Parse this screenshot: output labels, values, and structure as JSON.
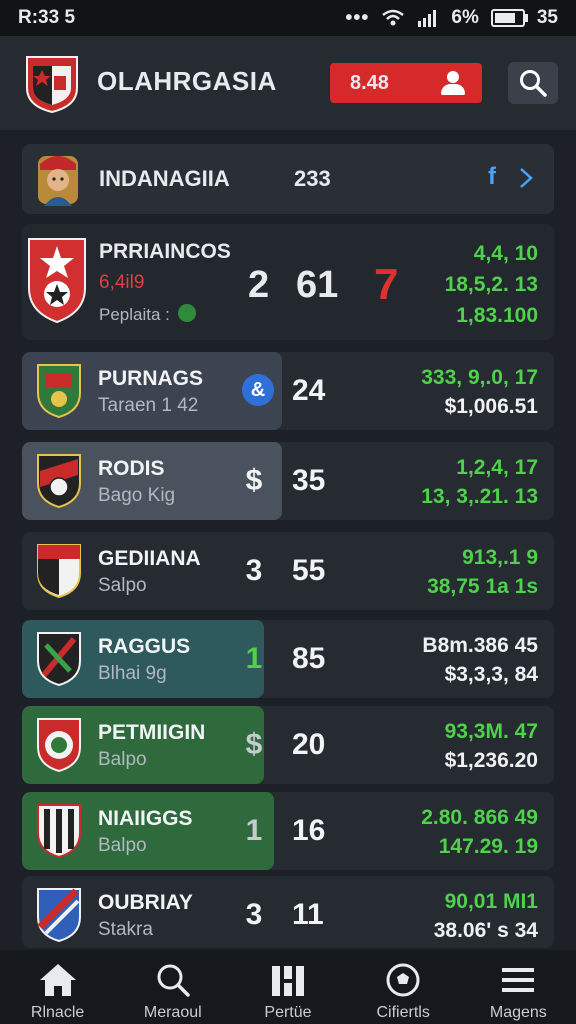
{
  "status": {
    "time": "R:33 5",
    "battery_text": "6%",
    "signal_text": "35",
    "battery_level": 0.85
  },
  "header": {
    "title": "OLAHRGASIA",
    "balance": "8.48",
    "icons": [
      "club-crest-icon",
      "user-icon",
      "search-icon"
    ]
  },
  "featured": {
    "name": "INDANAGIIA",
    "value": "233",
    "accent": "#4aa3ff"
  },
  "main_match": {
    "name": "PRRIAINCOS",
    "sub1": "6,4il9",
    "sub2": "Peplaita :",
    "score_left": "2",
    "score_mid": "61",
    "score_right": "7",
    "odds": [
      "4,4, 10",
      "18,5,2. 13",
      "1,83.100"
    ]
  },
  "rows": [
    {
      "name": "PURNAGS",
      "sub": "Taraen 1 42",
      "left": "",
      "mid": "24",
      "odds1": "333, 9,.0, 17",
      "odds2": "$1,006.51",
      "odds1_color": "green",
      "odds2_color": "white"
    },
    {
      "name": "RODIS",
      "sub": "Bago Kig",
      "left": "$",
      "mid": "35",
      "odds1": "1,2,4, 17",
      "odds2": "13, 3,.21. 13",
      "odds1_color": "green",
      "odds2_color": "green"
    },
    {
      "name": "GEDIIANA",
      "sub": "Salpo",
      "left": "3",
      "mid": "55",
      "odds1": "913,.1  9",
      "odds2": "38,75 1a  1s",
      "odds1_color": "green",
      "odds2_color": "green"
    },
    {
      "name": "RAGGUS",
      "sub": "Blhai 9g",
      "left": "1",
      "mid": "85",
      "odds1": "B8m.386  45",
      "odds2": "$3,3,3, 84",
      "odds1_color": "white",
      "odds2_color": "white"
    },
    {
      "name": "PETMIIGIN",
      "sub": "Balpo",
      "left": "$",
      "mid": "20",
      "odds1": "93,3M. 47",
      "odds2": "$1,236.20",
      "odds1_color": "green",
      "odds2_color": "white"
    },
    {
      "name": "NIAIIGGS",
      "sub": "Balpo",
      "left": "1",
      "mid": "16",
      "odds1": "2.80. 866  49",
      "odds2": "147.29. 19",
      "odds1_color": "green",
      "odds2_color": "green"
    },
    {
      "name": "OUBRIAY",
      "sub": "Stakra",
      "left": "3",
      "mid": "11",
      "odds1": "90,01 MI1",
      "odds2": "38.06' s 34",
      "odds1_color": "green",
      "odds2_color": "white"
    }
  ],
  "nav": [
    {
      "label": "Rlnacle",
      "icon": "home-icon"
    },
    {
      "label": "Meraoul",
      "icon": "search-icon"
    },
    {
      "label": "Pertüe",
      "icon": "bars-icon"
    },
    {
      "label": "Cifiertls",
      "icon": "soccer-ball-icon"
    },
    {
      "label": "Magens",
      "icon": "menu-icon"
    }
  ]
}
